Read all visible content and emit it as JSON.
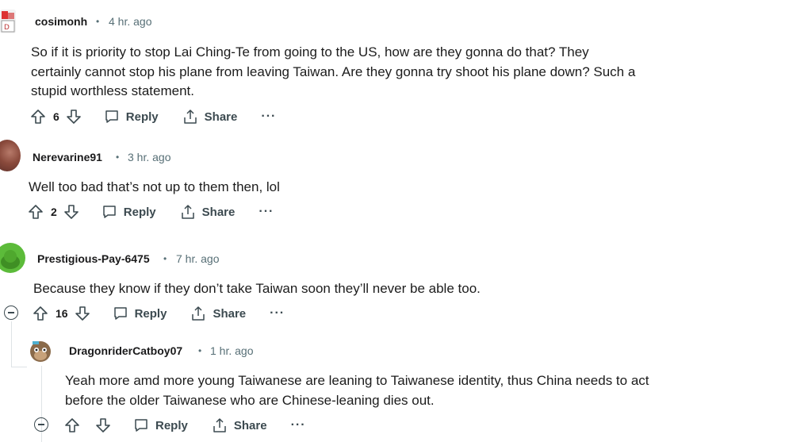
{
  "comments": [
    {
      "username": "cosimonh",
      "time": "4 hr. ago",
      "text": "So if it is priority to stop Lai Ching-Te from going to the US, how are they gonna do that? They certainly cannot stop his plane from leaving Taiwan. Are they gonna try shoot his plane down? Such a stupid worthless statement.",
      "votes": "6"
    },
    {
      "username": "Nerevarine91",
      "time": "3 hr. ago",
      "text": "Well too bad that’s not up to them then, lol",
      "votes": "2"
    },
    {
      "username": "Prestigious-Pay-6475",
      "time": "7 hr. ago",
      "text": "Because they know if they don’t take Taiwan soon they’ll never be able too.",
      "votes": "16"
    },
    {
      "username": "DragonriderCatboy07",
      "time": "1 hr. ago",
      "text": "Yeah more amd more young Taiwanese are leaning to Taiwanese identity, thus China needs to act before the older Taiwanese who are Chinese-leaning dies out.",
      "votes": ""
    }
  ],
  "labels": {
    "reply": "Reply",
    "share": "Share",
    "more": "···",
    "separator": "•"
  },
  "colors": {
    "meta": "#576f76",
    "action": "#3c4a50",
    "line": "#dfe3e6"
  }
}
